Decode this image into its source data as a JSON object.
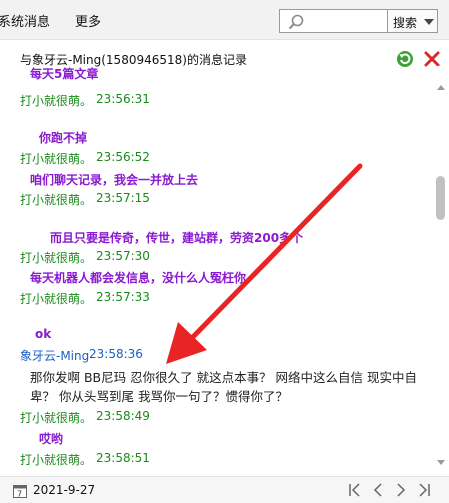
{
  "toolbar": {
    "menu_system": "系统消息",
    "menu_more": "更多",
    "search_placeholder": "",
    "search_button": "搜索"
  },
  "header": {
    "title": "与象牙云-Ming(1580946518)的消息记录"
  },
  "messages": [
    {
      "sender": "打小就很萌。",
      "time": "23:56:31",
      "text": "每天5篇文章"
    },
    {
      "sender": "打小就很萌。",
      "time": "23:56:52",
      "text": "你跑不掉"
    },
    {
      "sender": "打小就很萌。",
      "time": "23:57:15",
      "text": "咱们聊天记录，我会一并放上去"
    },
    {
      "sender": "打小就很萌。",
      "time": "23:57:30",
      "text": "而且只要是传奇，传世，建站群，劳资200多个"
    },
    {
      "sender": "打小就很萌。",
      "time": "23:57:33",
      "text": "每天机器人都会发信息，没什么人冤枉你"
    },
    {
      "sender": "象牙云-Ming",
      "time": "23:58:36",
      "text": "ok"
    },
    {
      "sender": "打小就很萌。",
      "time": "23:58:49",
      "text": "那你发啊  BB尼玛   忍你很久了    就这点本事？  网络中这么自信  现实中自卑？  你从头骂到尾   我骂你一句了？惯得你了？"
    },
    {
      "sender": "打小就很萌。",
      "time": "23:58:51",
      "text": "哎哟"
    }
  ],
  "footer": {
    "date": "2021-9-27"
  },
  "colors": {
    "sender_green": "#1a8a1a",
    "sender_blue": "#1a5fc4",
    "message_purple": "#8a1ad0",
    "annotation_red": "#e82424"
  }
}
